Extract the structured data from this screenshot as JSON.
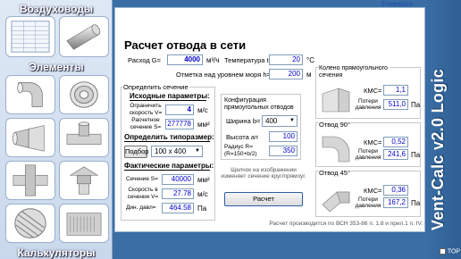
{
  "sidebar": {
    "title_ducts": "Воздуховоды",
    "title_elements": "Элементы",
    "title_calculators": "Калькуляторы"
  },
  "header": {
    "freeware": "Freeware"
  },
  "app_title": "Vent-Calc v2.0 Logic",
  "top_checkbox_label": "TOP",
  "main": {
    "title": "Расчет отвода в сети",
    "flow_label": "Расход G=",
    "flow_value": "4000",
    "flow_unit": "м³/ч",
    "temp_label": "Температура t=",
    "temp_value": "20",
    "temp_unit": "°C",
    "altitude_label": "Отметка над уровнем моря h=",
    "altitude_value": "200",
    "altitude_unit": "м",
    "section_label": "Определить сечение",
    "input_params_label": "Исходные параметры:",
    "speed_limit_label": "Ограничить скорость V=",
    "speed_limit_value": "4",
    "speed_limit_unit": "м/с",
    "calc_section_label": "Расчетное сечение S=",
    "calc_section_value": "277778",
    "calc_section_unit": "мм²",
    "size_label": "Определить типоразмер:",
    "pick_button": "Подбор",
    "size_select": "100 x 400",
    "actual_params_label": "Фактические параметры:",
    "section_s_label": "Сечение S=",
    "section_s_value": "40000",
    "section_s_unit": "мм²",
    "speed_label": "Скорость в сечении V=",
    "speed_value": "27.78",
    "speed_unit": "м/с",
    "dyn_label": "Дин. давл=",
    "dyn_value": "464.58",
    "dyn_unit": "Па",
    "config_label": "Конфигурация прямоугольных отводов",
    "width_label": "Ширина b=",
    "width_select": "400",
    "height_label": "Высота a=",
    "height_value": "100",
    "radius_label": "Радиус R= (R=150+b/2)",
    "radius_value": "350",
    "click_note": "Щелчок на изображении изменяет сечение круг/прямоуг.",
    "calc_button": "Расчет",
    "footer_note": "Расчет производится по ВСН 353-86 п. 1.8 и прил.1 п. IV.",
    "elbow_rect_label": "Колено прямоугольного сечения",
    "elbow_rect_kms_label": "КМС=",
    "elbow_rect_kms": "1,1",
    "elbow_rect_loss_label": "Потери давления",
    "elbow_rect_loss": "511,0",
    "elbow_rect_unit": "Па",
    "elbow90_label": "Отвод 90°",
    "elbow90_kms_label": "КМС=",
    "elbow90_kms": "0,52",
    "elbow90_loss_label": "Потери давления",
    "elbow90_loss": "241,6",
    "elbow90_unit": "Па",
    "elbow45_label": "Отвод 45°",
    "elbow45_kms_label": "КМС=",
    "elbow45_kms": "0,36",
    "elbow45_loss_label": "Потери давления",
    "elbow45_loss": "167,2",
    "elbow45_unit": "Па"
  }
}
